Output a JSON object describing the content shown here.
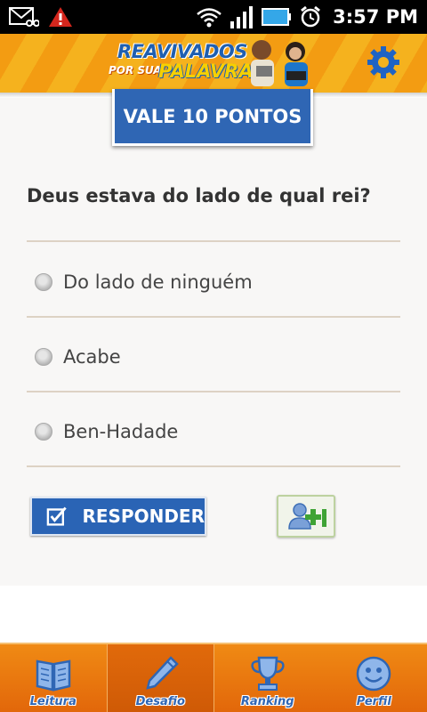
{
  "status_bar": {
    "time": "3:57 PM"
  },
  "header": {
    "logo_line1": "REAVIVADOS",
    "logo_line2": "POR SUA",
    "logo_line3": "PALAVRA"
  },
  "quiz": {
    "points_label": "VALE 10 PONTOS",
    "question": "Deus estava do lado de qual rei?",
    "options": [
      {
        "label": "Do lado de ninguém",
        "selected": false
      },
      {
        "label": "Acabe",
        "selected": false
      },
      {
        "label": "Ben-Hadade",
        "selected": false
      }
    ],
    "answer_button": "RESPONDER"
  },
  "bottom_nav": {
    "active": "Desafio",
    "items": [
      {
        "label": "Leitura",
        "icon": "book-icon"
      },
      {
        "label": "Desafio",
        "icon": "pencil-icon"
      },
      {
        "label": "Ranking",
        "icon": "trophy-icon"
      },
      {
        "label": "Perfil",
        "icon": "smiley-icon"
      }
    ]
  },
  "colors": {
    "accent_blue": "#2f66b4",
    "nav_orange": "#e8740c"
  }
}
